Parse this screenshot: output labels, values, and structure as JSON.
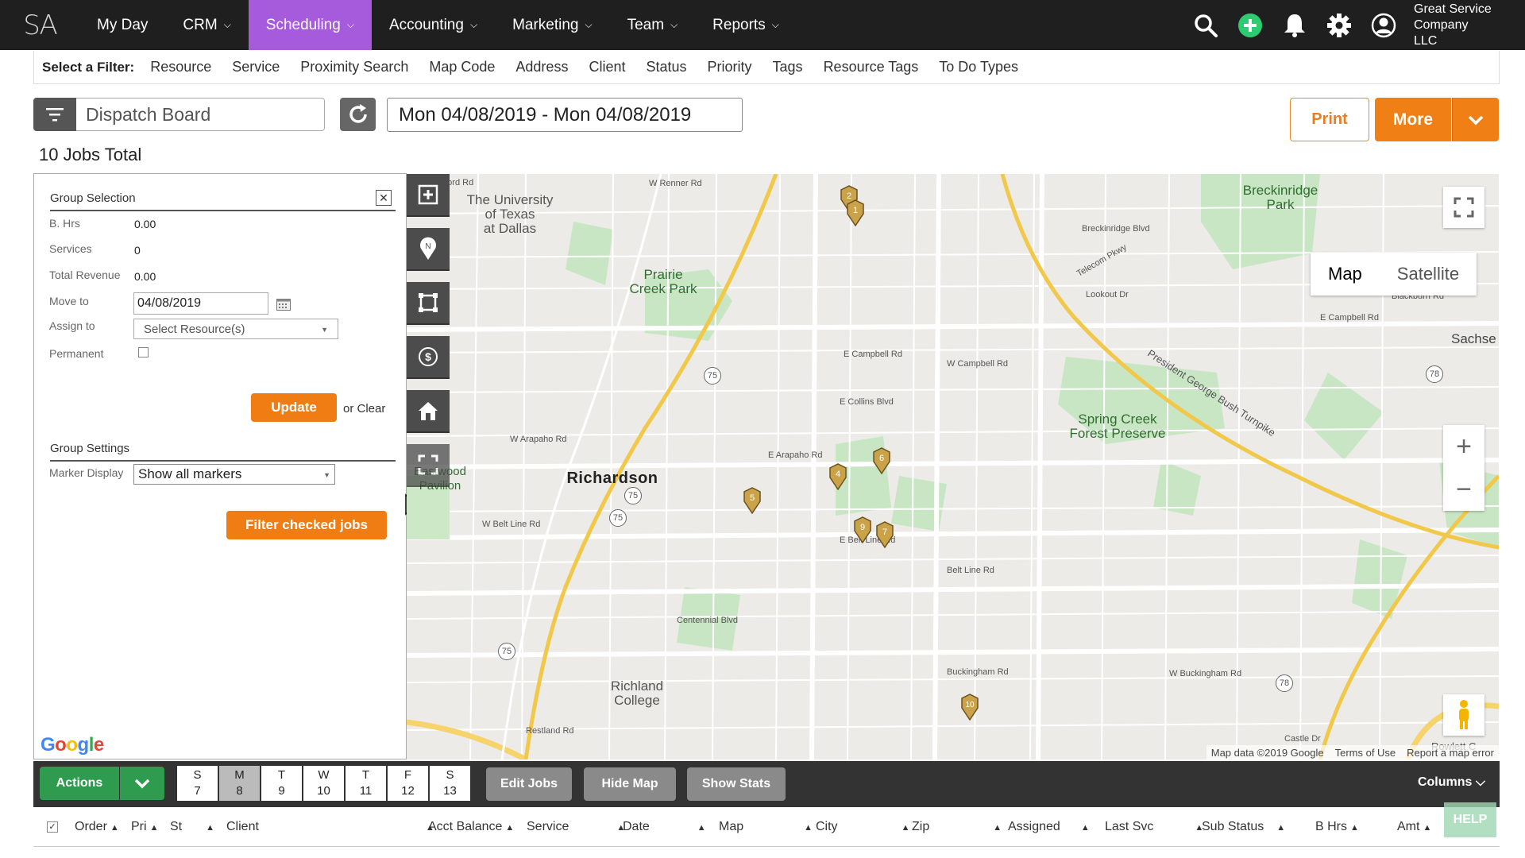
{
  "app": {
    "logo": "SA",
    "company_line1": "Great Service",
    "company_line2": "Company LLC"
  },
  "nav": {
    "my_day": "My Day",
    "crm": "CRM",
    "scheduling": "Scheduling",
    "accounting": "Accounting",
    "marketing": "Marketing",
    "team": "Team",
    "reports": "Reports"
  },
  "filters": {
    "label": "Select a Filter:",
    "items": [
      "Resource",
      "Service",
      "Proximity Search",
      "Map Code",
      "Address",
      "Client",
      "Status",
      "Priority",
      "Tags",
      "Resource Tags",
      "To Do Types"
    ]
  },
  "toolbar": {
    "board_name": "Dispatch Board",
    "date_range": "Mon 04/08/2019 - Mon 04/08/2019",
    "print": "Print",
    "more": "More",
    "jobs_total": "10 Jobs Total"
  },
  "group": {
    "title": "Group Selection",
    "close": "✕",
    "bhrs_label": "B. Hrs",
    "bhrs_value": "0.00",
    "services_label": "Services",
    "services_value": "0",
    "revenue_label": "Total Revenue",
    "revenue_value": "0.00",
    "move_label": "Move to",
    "move_value": "04/08/2019",
    "assign_label": "Assign to",
    "assign_placeholder": "Select Resource(s)",
    "permanent_label": "Permanent",
    "update": "Update",
    "or_clear": "or  Clear",
    "settings_title": "Group Settings",
    "marker_label": "Marker Display",
    "marker_value": "Show all markers",
    "filter_checked": "Filter checked jobs"
  },
  "map": {
    "type_map": "Map",
    "type_satellite": "Satellite",
    "google": "Google",
    "footer_data": "Map data ©2019 Google",
    "footer_terms": "Terms of Use",
    "footer_report": "Report a map error",
    "labels": {
      "utd": "The University\nof Texas\nat Dallas",
      "prairie": "Prairie\nCreek Park",
      "breck": "Breckinridge\nPark",
      "richardson": "Richardson",
      "spring": "Spring Creek\nForest Preserve",
      "richland": "Richland\nCollege",
      "sachse": "Sachse",
      "eastwood": "Eastwood\nPavilion",
      "frankford": "Frankford Rd",
      "renner": "W Renner Rd",
      "campbell_w": "E Campbell Rd",
      "campbell_e": "W Campbell Rd",
      "collins": "E Collins Blvd",
      "arapaho_w": "W Arapaho Rd",
      "arapaho_e": "E Arapaho Rd",
      "beltline_w": "W Belt Line Rd",
      "beltline_e": "E Belt Line Rd",
      "beltline_2": "Belt Line Rd",
      "buckingham": "Buckingham Rd",
      "buckingham_w": "W Buckingham Rd",
      "pgbt": "President George Bush Turnpike",
      "lookout": "Lookout Dr",
      "centennial": "Centennial Blvd",
      "restland": "Restland Rd",
      "castle": "Castle Dr",
      "blackburn": "Blackburn Rd",
      "campbell_far": "E Campbell Rd",
      "breck_blvd": "Breckinridge Blvd",
      "telecom": "Telecom Pkwy",
      "hwy75a": "75",
      "hwy75b": "75",
      "hwy75c": "75",
      "hwy75d": "75",
      "hwy78a": "78",
      "hwy78b": "78",
      "rowlett": "Rowlett C"
    },
    "markers": [
      "1",
      "2",
      "4",
      "5",
      "6",
      "7",
      "9",
      "10"
    ]
  },
  "bottom": {
    "actions": "Actions",
    "days": [
      {
        "d": "S",
        "n": "7"
      },
      {
        "d": "M",
        "n": "8"
      },
      {
        "d": "T",
        "n": "9"
      },
      {
        "d": "W",
        "n": "10"
      },
      {
        "d": "T",
        "n": "11"
      },
      {
        "d": "F",
        "n": "12"
      },
      {
        "d": "S",
        "n": "13"
      }
    ],
    "edit_jobs": "Edit Jobs",
    "hide_map": "Hide Map",
    "show_stats": "Show Stats",
    "columns": "Columns"
  },
  "table": {
    "headers": [
      "Order",
      "Pri",
      "St",
      "Client",
      "Acct Balance",
      "Service",
      "Date",
      "Map",
      "City",
      "Zip",
      "Assigned",
      "Last Svc",
      "Sub Status",
      "B Hrs",
      "Amt"
    ],
    "help": "HELP"
  },
  "colors": {
    "nav_bg": "#1f1f1f",
    "active_nav": "#a55bdc",
    "accent": "#f07f16",
    "green": "#2e9b4e",
    "add_icon": "#2ecc71"
  }
}
